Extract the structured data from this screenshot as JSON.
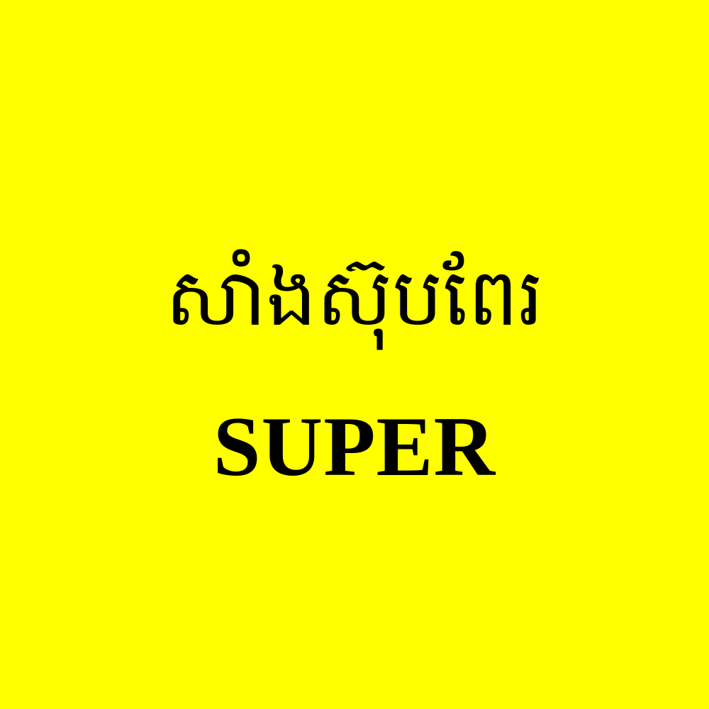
{
  "background_color": "#FFFF00",
  "text_color": "#000000",
  "title_khmer": "សាំងស៊ុបពែរ",
  "title_latin": "SUPER"
}
